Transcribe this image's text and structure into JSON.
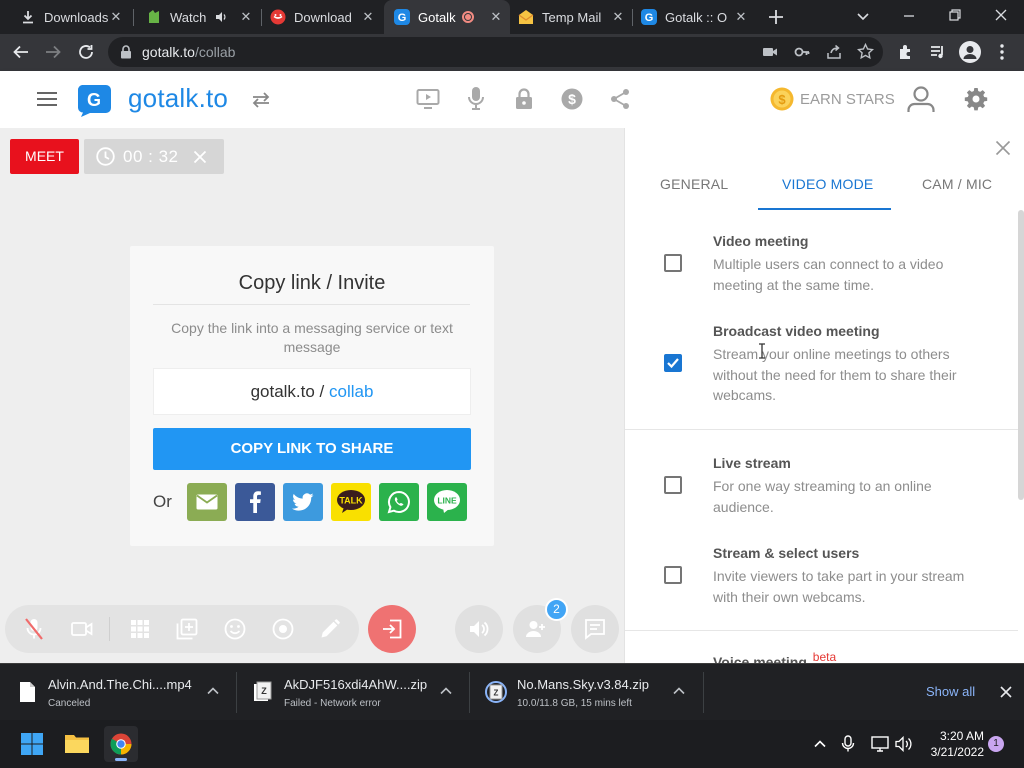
{
  "browser": {
    "tabs": [
      {
        "title": "Downloads",
        "icon": "download-icon"
      },
      {
        "title": "Watch",
        "icon": "watch-site-icon",
        "audio": "speaker-icon"
      },
      {
        "title": "Download",
        "icon": "download-site-icon"
      },
      {
        "title": "Gotalk",
        "icon": "gotalk-icon",
        "recording": true
      },
      {
        "title": "Temp Mail",
        "icon": "temp-mail-icon"
      },
      {
        "title": "Gotalk :: O",
        "icon": "gotalk-icon"
      }
    ],
    "url_domain": "gotalk.to",
    "url_path": "/collab"
  },
  "app": {
    "logo_text": "gotalk.to",
    "earn_stars": "EARN STARS",
    "meet_label": "MEET",
    "timer": "00 : 32"
  },
  "invite": {
    "title": "Copy link / Invite",
    "description": "Copy the link into a messaging service or text message",
    "link_domain": "gotalk.to",
    "link_sep": " / ",
    "link_room": "collab",
    "copy_button": "COPY LINK TO SHARE",
    "or_label": "Or",
    "share_services": [
      "email",
      "facebook",
      "twitter",
      "kakaotalk",
      "whatsapp",
      "line"
    ],
    "kakao_label": "TALK",
    "line_label": "LINE"
  },
  "controls": {
    "participants_badge": "2"
  },
  "settings_panel": {
    "tabs": [
      "GENERAL",
      "VIDEO MODE",
      "CAM / MIC"
    ],
    "active_tab": "VIDEO MODE",
    "options": [
      {
        "title": "Video meeting",
        "description": "Multiple users can connect to a video meeting at the same time.",
        "checked": false
      },
      {
        "title": "Broadcast video meeting",
        "description": "Stream your online meetings to others without the need for them to share their webcams.",
        "checked": true
      },
      {
        "title": "Live stream",
        "description": "For one way streaming to an online audience.",
        "checked": false
      },
      {
        "title": "Stream & select users",
        "description": "Invite viewers to take part in your stream with their own webcams.",
        "checked": false
      },
      {
        "title": "Voice meeting",
        "badge": "beta"
      }
    ]
  },
  "downloads": {
    "items": [
      {
        "name": "Alvin.And.The.Chi....mp4",
        "status": "Canceled"
      },
      {
        "name": "AkDJF516xdi4AhW....zip",
        "status": "Failed - Network error"
      },
      {
        "name": "No.Mans.Sky.v3.84.zip",
        "status": "10.0/11.8 GB, 15 mins left"
      }
    ],
    "show_all": "Show all"
  },
  "taskbar": {
    "time": "3:20 AM",
    "date": "3/21/2022",
    "notification_count": "1"
  },
  "colors": {
    "meet_red": "#e8111d",
    "primary_blue": "#2196f3",
    "active_tab_blue": "#1976d2",
    "star_gold": "#f5b82e"
  }
}
